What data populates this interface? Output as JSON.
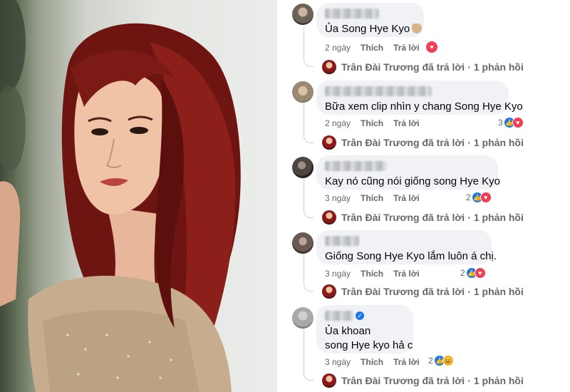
{
  "photo": {
    "description_icon": "portrait-photo"
  },
  "comments": [
    {
      "text": "Ủa Song Hye Kyo",
      "has_hand_emoji": true,
      "time": "2 ngày",
      "like_label": "Thích",
      "reply_label": "Trả lời",
      "reaction_count": "",
      "reply_author": "Trân Đài Trương đã trả lời",
      "reply_count": "1 phản hồi"
    },
    {
      "text": "Bữa xem clip nhìn y chang Song Hye Kyo",
      "time": "2 ngày",
      "like_label": "Thích",
      "reply_label": "Trả lời",
      "reaction_count": "3",
      "reply_author": "Trân Đài Trương đã trả lời",
      "reply_count": "1 phản hồi"
    },
    {
      "text": "Kay nó cũng nói giống song Hye Kyo",
      "time": "3 ngày",
      "like_label": "Thích",
      "reply_label": "Trả lời",
      "reaction_count": "2",
      "reply_author": "Trân Đài Trương đã trả lời",
      "reply_count": "1 phản hồi"
    },
    {
      "text": "Giống Song Hye Kyo lắm luôn á chị.",
      "time": "3 ngày",
      "like_label": "Thích",
      "reply_label": "Trả lời",
      "reaction_count": "2",
      "reply_author": "Trân Đài Trương đã trả lời",
      "reply_count": "1 phản hồi"
    },
    {
      "text_line1": "Ủa khoan",
      "text_line2": "song Hye kyo hả c",
      "time": "3 ngày",
      "like_label": "Thích",
      "reply_label": "Trả lời",
      "reaction_count": "2",
      "reply_author": "Trân Đài Trương đã trả lời",
      "reply_count": "1 phản hồi"
    }
  ],
  "colors": {
    "bubble": "#f0f2f5",
    "meta_text": "#65676b",
    "like_blue": "#1877f2",
    "love_red": "#f33e58",
    "haha_yellow": "#f7b125"
  }
}
